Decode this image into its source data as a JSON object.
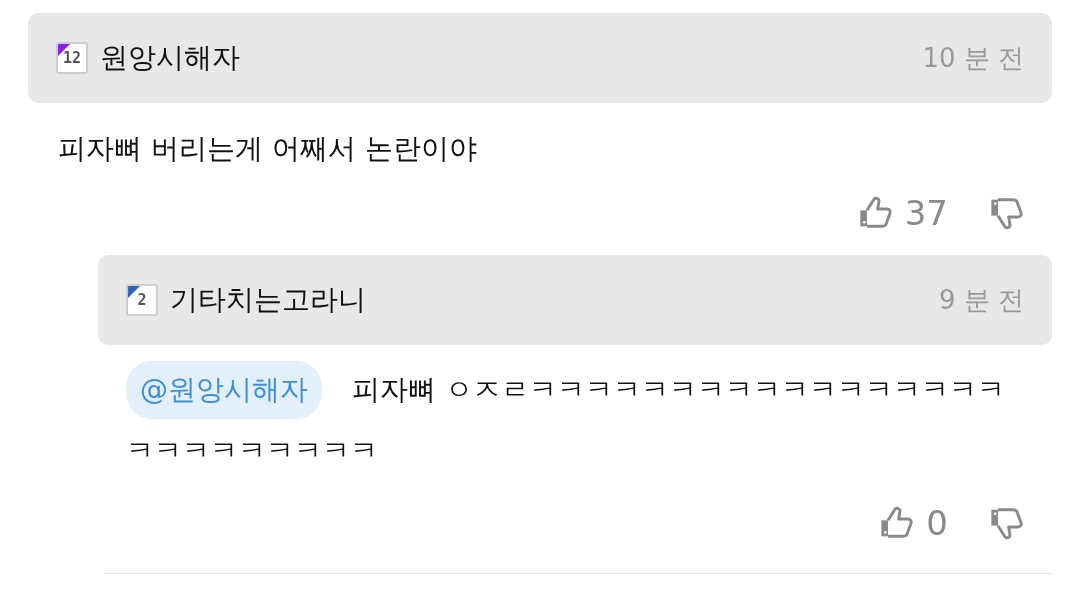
{
  "comments": [
    {
      "level": "12",
      "color": "#8b1ee8",
      "author": "원앙시해자",
      "time": "10 분 전",
      "text": "피자뼈 버리는게 어째서 논란이야",
      "likes": "37",
      "replies": [
        {
          "level": "2",
          "color": "#2f64b8",
          "author": "기타치는고라니",
          "time": "9 분 전",
          "mention": "@원앙시해자",
          "text": "피자뼈 ㅇㅈㄹㅋㅋㅋㅋㅋㅋㅋㅋㅋㅋㅋㅋㅋㅋㅋㅋㅋㅋㅋㅋㅋㅋㅋㅋㅋㅋ",
          "likes": "0"
        }
      ]
    }
  ]
}
